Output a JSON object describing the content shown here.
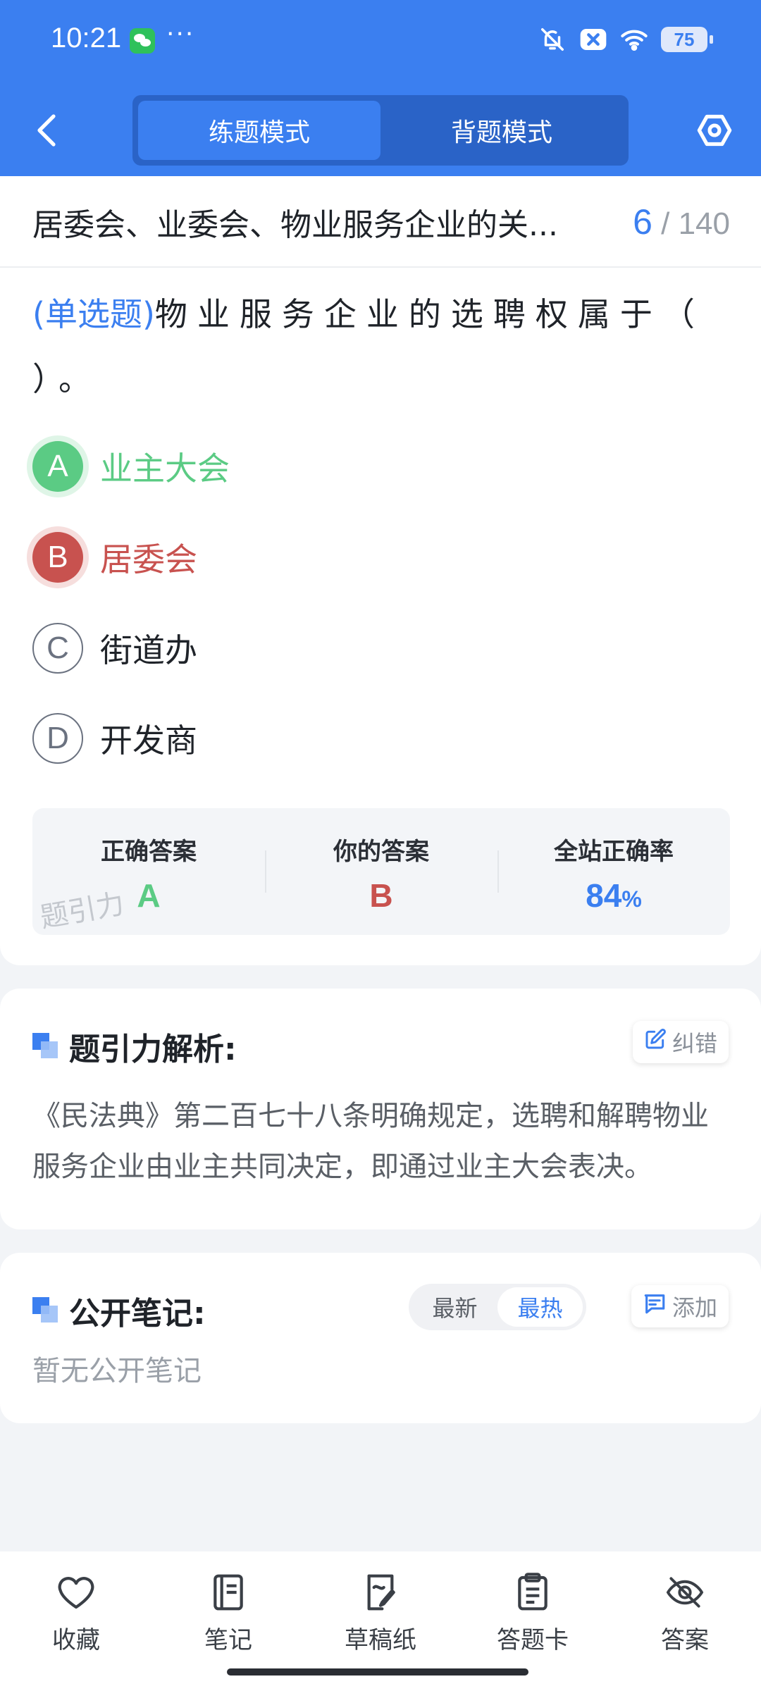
{
  "status_bar": {
    "time": "10:21",
    "notification_dots": "···",
    "battery": "75"
  },
  "header": {
    "mode_tabs": [
      {
        "label": "练题模式",
        "active": true
      },
      {
        "label": "背题模式",
        "active": false
      }
    ]
  },
  "question": {
    "title": "居委会、业委会、物业服务企业的关...",
    "progress_current": "6",
    "progress_sep": "/",
    "progress_total": "140",
    "type": "(单选题)",
    "text": "物业服务企业的选聘权属于（ ）。",
    "options": [
      {
        "letter": "A",
        "label": "业主大会",
        "state": "correct"
      },
      {
        "letter": "B",
        "label": "居委会",
        "state": "wrong"
      },
      {
        "letter": "C",
        "label": "街道办",
        "state": "none"
      },
      {
        "letter": "D",
        "label": "开发商",
        "state": "none"
      }
    ]
  },
  "answer_summary": {
    "correct_label": "正确答案",
    "correct_value": "A",
    "yours_label": "你的答案",
    "yours_value": "B",
    "rate_label": "全站正确率",
    "rate_value": "84",
    "rate_unit": "%",
    "watermark": "题引力"
  },
  "analysis": {
    "title": "题引力解析:",
    "correct_button": "纠错",
    "text": "《民法典》第二百七十八条明确规定，选聘和解聘物业服务企业由业主共同决定，即通过业主大会表决。"
  },
  "notes": {
    "title": "公开笔记:",
    "sort_options": [
      "最新",
      "最热"
    ],
    "active_sort": "最热",
    "add_button": "添加",
    "empty_text": "暂无公开笔记"
  },
  "bottom_bar": [
    {
      "label": "收藏",
      "icon": "heart-icon"
    },
    {
      "label": "笔记",
      "icon": "notebook-icon"
    },
    {
      "label": "草稿纸",
      "icon": "draft-paper-icon"
    },
    {
      "label": "答题卡",
      "icon": "answer-sheet-icon"
    },
    {
      "label": "答案",
      "icon": "eye-off-icon"
    }
  ],
  "colors": {
    "primary": "#3b7ff0",
    "correct": "#5bcb84",
    "wrong": "#c8524f"
  }
}
